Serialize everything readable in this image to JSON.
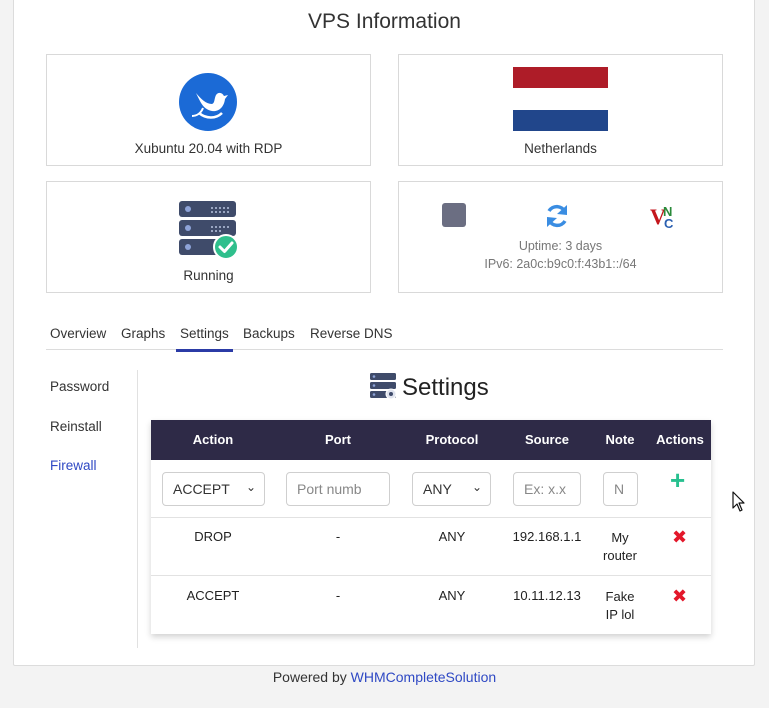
{
  "page": {
    "title": "VPS Information"
  },
  "cards": {
    "os": {
      "label": "Xubuntu 20.04 with RDP",
      "icon": "xubuntu-logo"
    },
    "location": {
      "label": "Netherlands",
      "icon": "netherlands-flag",
      "flag_colors": [
        "#ae1c28",
        "#ffffff",
        "#21468b"
      ]
    },
    "status": {
      "label": "Running",
      "icon": "server-running-icon"
    },
    "controls": {
      "uptime": "Uptime: 3 days",
      "ipv6": "IPv6: 2a0c:b9c0:f:43b1::/64",
      "buttons": [
        "stop-icon",
        "restart-icon",
        "vnc-icon"
      ],
      "vnc_text": "VNC"
    }
  },
  "tabs": [
    "Overview",
    "Graphs",
    "Settings",
    "Backups",
    "Reverse DNS"
  ],
  "active_tab": "Settings",
  "sidebar": {
    "items": [
      "Password",
      "Reinstall",
      "Firewall"
    ],
    "active": "Firewall"
  },
  "settings": {
    "title": "Settings",
    "icon": "server-settings-icon"
  },
  "firewall": {
    "headers": [
      "Action",
      "Port",
      "Protocol",
      "Source",
      "Note",
      "Actions"
    ],
    "new_rule": {
      "action": "ACCEPT",
      "port_placeholder": "Port numb",
      "protocol": "ANY",
      "source_placeholder": "Ex: x.x",
      "note_placeholder": "N"
    },
    "rows": [
      {
        "action": "DROP",
        "port": "-",
        "protocol": "ANY",
        "source": "192.168.1.1",
        "note": "My router"
      },
      {
        "action": "ACCEPT",
        "port": "-",
        "protocol": "ANY",
        "source": "10.11.12.13",
        "note": "Fake IP lol"
      }
    ]
  },
  "footer": {
    "prefix": "Powered by",
    "link": "WHMCompleteSolution"
  },
  "colors": {
    "header_bg": "#2e2a47",
    "accent": "#2f49c4",
    "add": "#27c08f",
    "delete": "#e3172a"
  }
}
